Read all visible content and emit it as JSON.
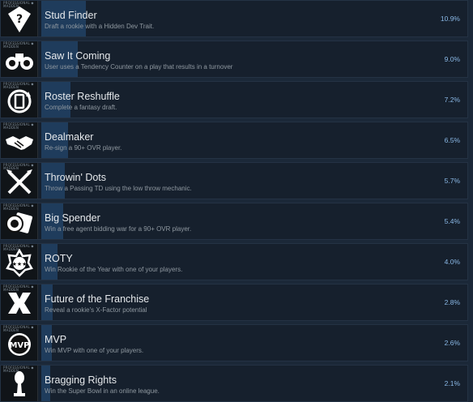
{
  "icon_tag": "PROFESSIONAL ◆ MADDEN",
  "colors": {
    "bar": "#1f3c5c",
    "percent": "#8ab8e6",
    "row_bg": "#16202d"
  },
  "achievements": [
    {
      "name": "Stud Finder",
      "description": "Draft a rookie with a Hidden Dev Trait.",
      "percent": "10.9%",
      "icon": "diamond-question-icon"
    },
    {
      "name": "Saw It Coming",
      "description": "User uses a Tendency Counter on a play that results in a turnover",
      "percent": "9.0%",
      "icon": "binoculars-icon"
    },
    {
      "name": "Roster Reshuffle",
      "description": "Complete a fantasy draft.",
      "percent": "7.2%",
      "icon": "cycle-card-icon"
    },
    {
      "name": "Dealmaker",
      "description": "Re-sign a 90+ OVR player.",
      "percent": "6.5%",
      "icon": "handshake-icon"
    },
    {
      "name": "Throwin' Dots",
      "description": "Throw a Passing TD using the low throw mechanic.",
      "percent": "5.7%",
      "icon": "crossed-darts-icon"
    },
    {
      "name": "Big Spender",
      "description": "Win a free agent bidding war for a 90+ OVR player.",
      "percent": "5.4%",
      "icon": "money-stack-icon"
    },
    {
      "name": "ROTY",
      "description": "Win Rookie of the Year with one of your players.",
      "percent": "4.0%",
      "icon": "star-shield-icon"
    },
    {
      "name": "Future of the Franchise",
      "description": "Reveal a rookie's X-Factor potential",
      "percent": "2.8%",
      "icon": "x-factor-icon"
    },
    {
      "name": "MVP",
      "description": "Win MVP with one of your players.",
      "percent": "2.6%",
      "icon": "mvp-badge-icon"
    },
    {
      "name": "Bragging Rights",
      "description": "Win the Super Bowl in an online league.",
      "percent": "2.1%",
      "icon": "trophy-icon"
    }
  ]
}
